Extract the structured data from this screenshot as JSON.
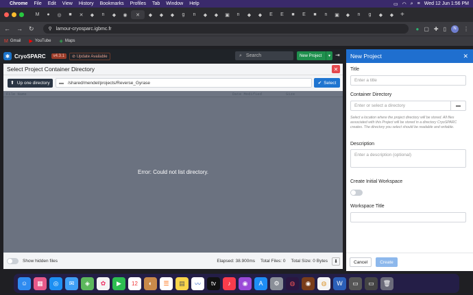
{
  "menubar": {
    "app": "Chrome",
    "menus": [
      "File",
      "Edit",
      "View",
      "History",
      "Bookmarks",
      "Profiles",
      "Tab",
      "Window",
      "Help"
    ],
    "clock": "Wed 12 Jun  1:56 PM"
  },
  "browser": {
    "url": "lamour-cryosparc.igbmc.fr",
    "bookmarks": [
      "Gmail",
      "YouTube",
      "Maps"
    ],
    "profile_initial": "N"
  },
  "app": {
    "brand": "CryoSPARC",
    "version": "v4.3.1",
    "update": "Update Available",
    "search_placeholder": "Search",
    "new_project": "New Project"
  },
  "modal": {
    "title": "Select Project Container Directory",
    "up_button": "Up one directory",
    "path": "/shared/mendel/projects/Reverse_Gyrase",
    "select_button": "Select",
    "columns": [
      "File Name",
      "Date Modified",
      "Size"
    ],
    "error": "Error: Could not list directory.",
    "show_hidden": "Show hidden files",
    "elapsed": "Elapsed: 38.900ms",
    "total_files": "Total Files: 0",
    "total_size": "Total Size: 0 Bytes"
  },
  "panel": {
    "title": "New Project",
    "title_label": "Title",
    "title_placeholder": "Enter a title",
    "container_label": "Container Directory",
    "container_placeholder": "Enter or select a directory",
    "help_text": "Select a location where the project directory will be stored. All files associated with this Project will be stored in a directory CryoSPARC creates. The directory you select should be readable and writable.",
    "description_label": "Description",
    "description_placeholder": "Enter a description (optional)",
    "workspace_label": "Create Initial Workspace",
    "workspace_title_label": "Workspace Title",
    "cancel": "Cancel",
    "create": "Create"
  },
  "dock": {
    "calendar_day": "12"
  },
  "colors": {
    "accent": "#1f6fcf",
    "new_project_green": "#1f8f4d",
    "close_red": "#e5484d",
    "version_badge": "#9a3d2a"
  }
}
